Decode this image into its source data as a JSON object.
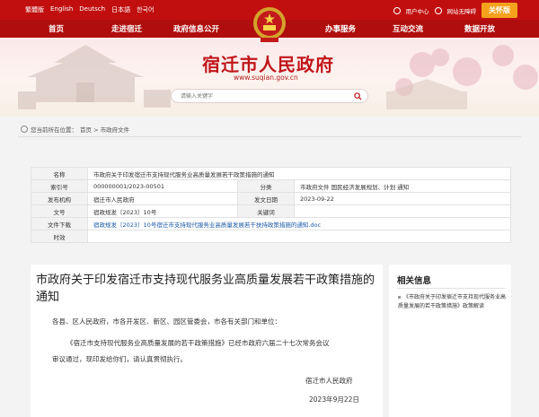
{
  "topbar": {
    "languages": [
      "繁體版",
      "English",
      "Deutsch",
      "日本語",
      "한국어"
    ],
    "user_center": "用户中心",
    "accessibility": "网站无障碍",
    "care_mode": "关怀版"
  },
  "nav": {
    "items": [
      "首页",
      "走进宿迁",
      "政府信息公开",
      "办事服务",
      "互动交流",
      "数据开放"
    ]
  },
  "banner": {
    "title": "宿迁市人民政府",
    "url": "www.suqian.gov.cn",
    "search_placeholder": "请输入关键字"
  },
  "location": {
    "prefix": "您当前所在位置：",
    "path": "首页 > 市政府文件"
  },
  "info": {
    "name_label": "名称",
    "name_value": "市政府关于印发宿迁市支持现代服务业高质量发展若干政策措施的通知",
    "index_label": "索引号",
    "index_value": "000000001/2023-00501",
    "category_label": "分类",
    "category_value": "市政府文件    国民经济发展规划、计划    通知",
    "issuer_label": "发布机构",
    "issuer_value": "宿迁市人民政府",
    "date_label": "发文日期",
    "date_value": "2023-09-22",
    "docno_label": "文号",
    "docno_value": "宿政规发〔2023〕10号",
    "keyword_label": "关键词",
    "keyword_value": "",
    "download_label": "文件下载",
    "download_value": "宿政规发〔2023〕10号宿迁市支持现代服务业高质量发展若干扶持政策措施的通知.doc",
    "validity_label": "时效",
    "validity_value": ""
  },
  "article": {
    "title": "市政府关于印发宿迁市支持现代服务业高质量发展若干政策措施的通知",
    "greeting": "各县、区人民政府，市各开发区、新区、园区管委会，市各有关部门和单位：",
    "body_line1": "《宿迁市支持现代服务业高质量发展的若干政策措施》已经市政府六届二十七次常务会议",
    "body_line2": "审议通过，现印发给你们，请认真贯彻执行。",
    "signature": "宿迁市人民政府",
    "sign_date": "2023年9月22日"
  },
  "sidebar": {
    "heading": "相关信息",
    "link": "《市政府关于印发宿迁市支持现代服务业高质量发展的若干政策措施》政策解读"
  },
  "colors": {
    "primary_red": "#c10f0f",
    "nav_red": "#b00e0e",
    "care_orange": "#f4a21c",
    "link_blue": "#1a5aa8"
  }
}
